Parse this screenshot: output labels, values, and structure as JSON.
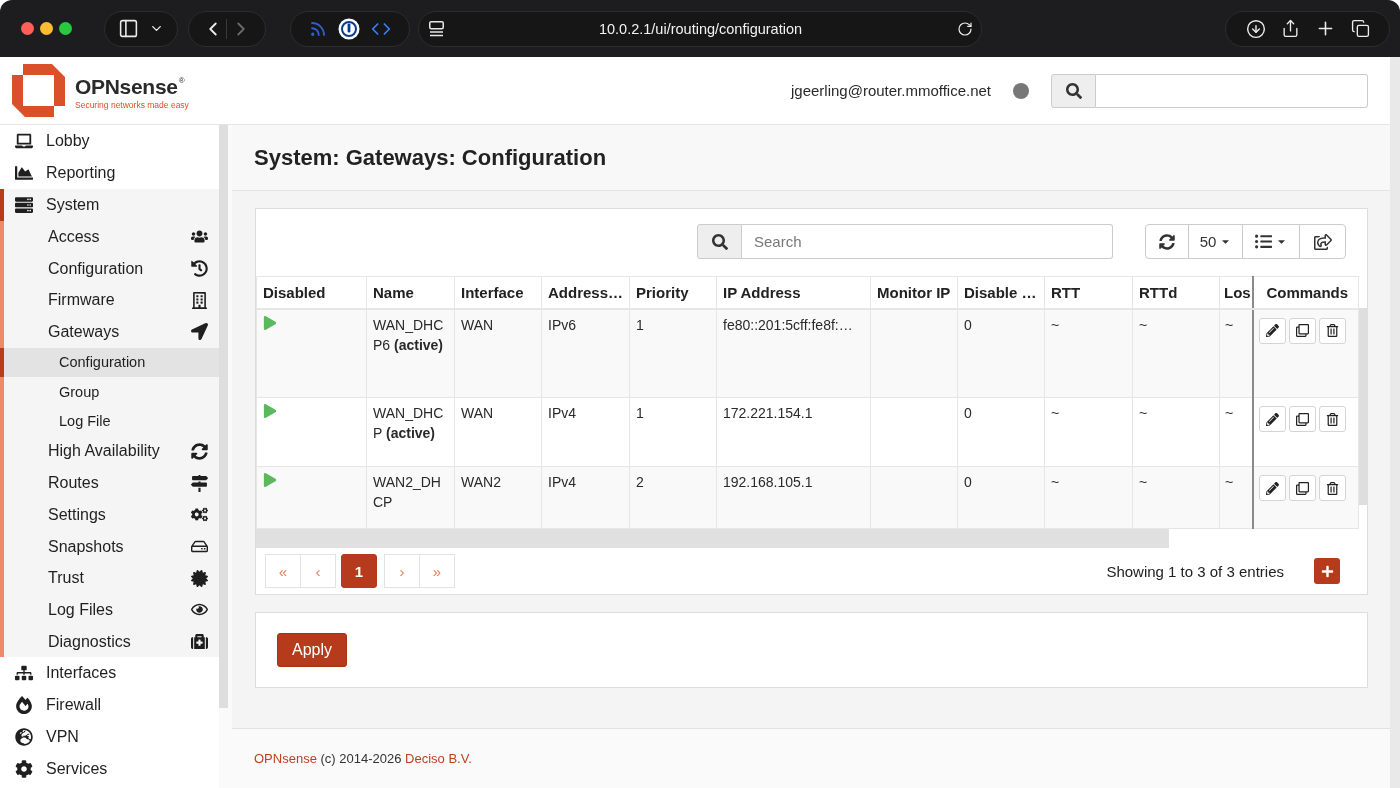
{
  "browser": {
    "url": "10.0.2.1/ui/routing/configuration"
  },
  "header": {
    "brand": "OPNsense",
    "brand_mark": "®",
    "tagline": "Securing networks made easy",
    "user": "jgeerling@router.mmoffice.net"
  },
  "sidebar": {
    "items": [
      {
        "label": "Lobby",
        "selected": false,
        "expanded": false
      },
      {
        "label": "Reporting",
        "selected": false,
        "expanded": false
      },
      {
        "label": "System",
        "selected": false,
        "expanded": true,
        "children": [
          {
            "label": "Access",
            "selected": false
          },
          {
            "label": "Configuration",
            "selected": false
          },
          {
            "label": "Firmware",
            "selected": false
          },
          {
            "label": "Gateways",
            "selected": false,
            "children": [
              {
                "label": "Configuration",
                "selected": true
              },
              {
                "label": "Group",
                "selected": false
              },
              {
                "label": "Log File",
                "selected": false
              }
            ]
          },
          {
            "label": "High Availability",
            "selected": false
          },
          {
            "label": "Routes",
            "selected": false
          },
          {
            "label": "Settings",
            "selected": false
          },
          {
            "label": "Snapshots",
            "selected": false
          },
          {
            "label": "Trust",
            "selected": false
          },
          {
            "label": "Log Files",
            "selected": false
          },
          {
            "label": "Diagnostics",
            "selected": false
          }
        ]
      },
      {
        "label": "Interfaces",
        "selected": false,
        "expanded": false
      },
      {
        "label": "Firewall",
        "selected": false,
        "expanded": false
      },
      {
        "label": "VPN",
        "selected": false,
        "expanded": false
      },
      {
        "label": "Services",
        "selected": false,
        "expanded": false
      }
    ]
  },
  "page_title": "System: Gateways: Configuration",
  "grid": {
    "search": {
      "placeholder": "Search"
    },
    "page_size": "50",
    "columns": [
      "Disabled",
      "Name",
      "Interface",
      "Address…",
      "Priority",
      "IP Address",
      "Monitor IP",
      "Disable …",
      "RTT",
      "RTTd",
      "Los",
      "Commands"
    ],
    "rows": [
      {
        "disabled": false,
        "name": "WAN_DHCP6 **(active)**",
        "interface": "WAN",
        "column_4": "IPv6",
        "priority": "1",
        "ip_address": "fe80::201:5cff:fe8f:…",
        "column_8": "0",
        "rtt": "~",
        "rttd": "~",
        "column_11": "~"
      },
      {
        "disabled": false,
        "name": "WAN_DHCP **(active)**",
        "interface": "WAN",
        "column_4": "IPv4",
        "priority": "1",
        "ip_address": "172.221.154.1",
        "column_8": "0",
        "rtt": "~",
        "rttd": "~",
        "column_11": "~"
      },
      {
        "disabled": false,
        "name": "WAN2_DHCP",
        "interface": "WAN2",
        "column_4": "IPv4",
        "priority": "2",
        "ip_address": "192.168.105.1",
        "column_8": "0",
        "rtt": "~",
        "rttd": "~",
        "column_11": "~"
      }
    ],
    "pagination": [
      {
        "label": "«",
        "selected": false
      },
      {
        "label": "‹",
        "selected": false
      },
      {
        "label": "1",
        "selected": true
      },
      {
        "label": "›",
        "selected": false
      },
      {
        "label": "»",
        "selected": false
      }
    ],
    "info": "Showing 1 to 3 of 3 entries"
  },
  "apply_button": "Apply",
  "footer": {
    "brand_link": "OPNsense",
    "copyright": "(c) 2014-2026",
    "company_link": "Deciso B.V."
  }
}
